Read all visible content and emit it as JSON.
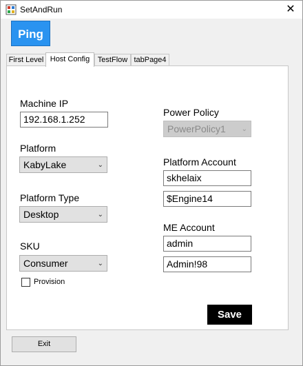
{
  "window": {
    "title": "SetAndRun",
    "close_glyph": "✕"
  },
  "toolbar": {
    "ping_label": "Ping"
  },
  "tabs": [
    {
      "label": "First Level",
      "active": false
    },
    {
      "label": "Host Config",
      "active": true
    },
    {
      "label": "TestFlow",
      "active": false
    },
    {
      "label": "tabPage4",
      "active": false
    }
  ],
  "host_config": {
    "machine_ip": {
      "label": "Machine IP",
      "value": "192.168.1.252"
    },
    "platform": {
      "label": "Platform",
      "value": "KabyLake"
    },
    "platform_type": {
      "label": "Platform Type",
      "value": "Desktop"
    },
    "sku": {
      "label": "SKU",
      "value": "Consumer"
    },
    "provision": {
      "label": "Provision",
      "checked": false
    },
    "power_policy": {
      "label": "Power Policy",
      "value": "PowerPolicy1",
      "enabled": false
    },
    "platform_account": {
      "label": "Platform Account",
      "username": "skhelaix",
      "password": "$Engine14"
    },
    "me_account": {
      "label": "ME Account",
      "username": "admin",
      "password": "Admin!98"
    },
    "save_label": "Save"
  },
  "footer": {
    "exit_label": "Exit"
  },
  "colors": {
    "ping_bg": "#2a93f0",
    "save_bg": "#000000"
  }
}
